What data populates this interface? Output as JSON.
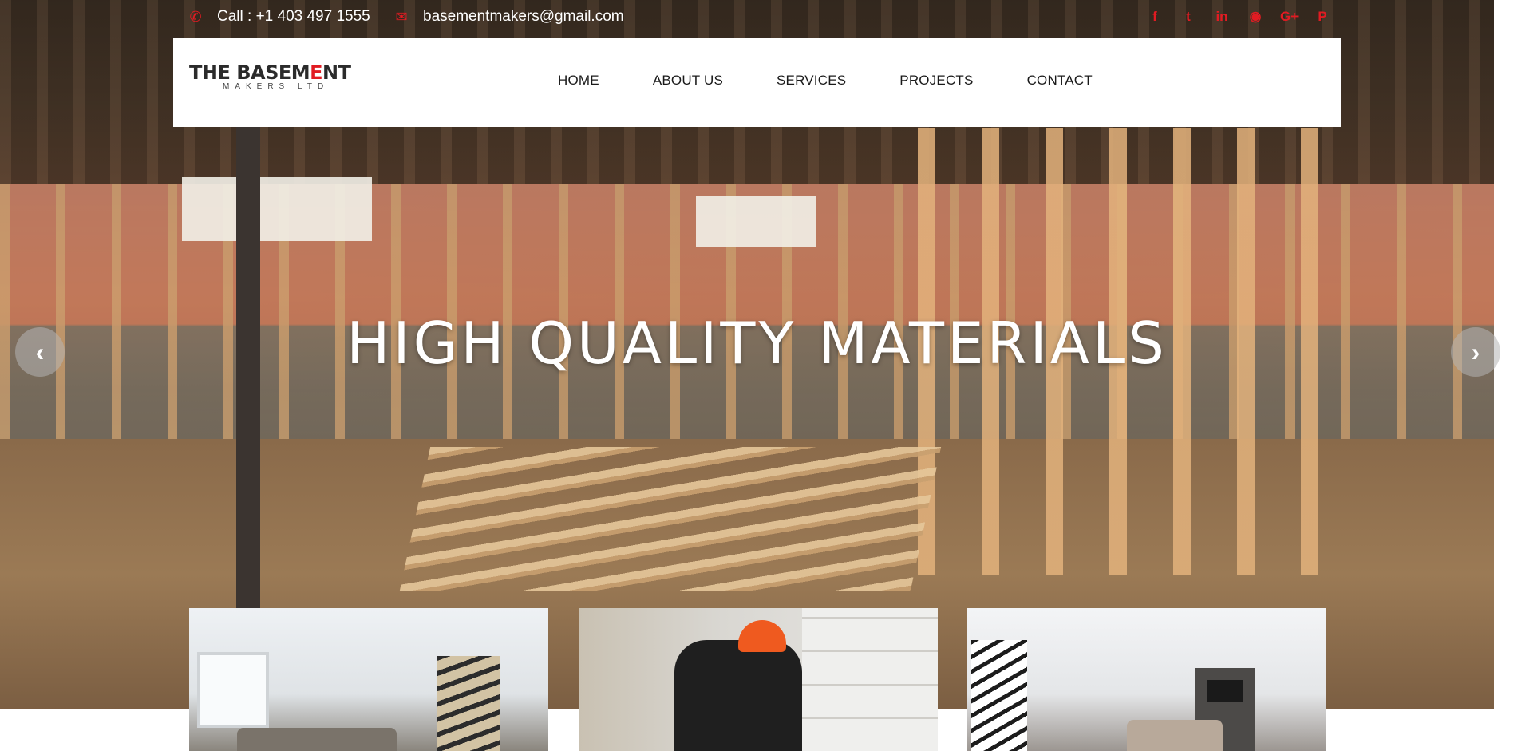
{
  "topbar": {
    "phone_icon": "phone-icon",
    "phone": "Call : +1 403 497 1555",
    "email_icon": "envelope-icon",
    "email": "basementmakers@gmail.com",
    "socials": [
      {
        "icon": "facebook-icon",
        "glyph": "f"
      },
      {
        "icon": "twitter-icon",
        "glyph": "t"
      },
      {
        "icon": "linkedin-icon",
        "glyph": "in"
      },
      {
        "icon": "rss-icon",
        "glyph": "◉"
      },
      {
        "icon": "google-plus-icon",
        "glyph": "G+"
      },
      {
        "icon": "pinterest-icon",
        "glyph": "P"
      }
    ],
    "accent_color": "#e11b22"
  },
  "logo": {
    "main_text": "THE BASEM",
    "accent_text": "E",
    "end_text": "NT",
    "sub_text": "MAKERS LTD."
  },
  "nav": {
    "items": [
      "HOME",
      "ABOUT US",
      "SERVICES",
      "PROJECTS",
      "CONTACT"
    ]
  },
  "hero": {
    "title": "HIGH QUALITY MATERIALS",
    "prev_glyph": "‹",
    "next_glyph": "›"
  },
  "cards": [
    {
      "subject": "finished basement living room"
    },
    {
      "subject": "worker with orange helmet building block wall"
    },
    {
      "subject": "finished basement with fireplace and stairs"
    }
  ]
}
